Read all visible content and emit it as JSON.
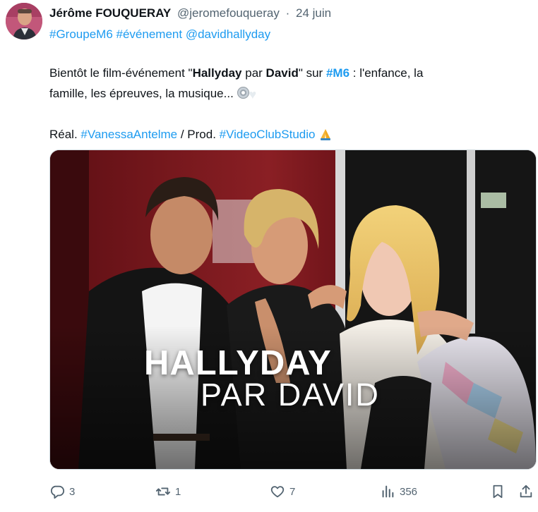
{
  "tweet": {
    "author_name": "Jérôme FOUQUERAY",
    "author_handle": "@jeromefouqueray",
    "separator": "·",
    "date": "24 juin",
    "hashtags": [
      {
        "text": "#GroupeM6"
      },
      {
        "text": "#événement"
      },
      {
        "text": "@davidhallyday"
      }
    ],
    "line1": {
      "p1": "Bientôt le film-événement \"",
      "b1": "Hallyday",
      "p2": " par ",
      "b2": "David",
      "p3": "\" sur ",
      "tag": "#M6",
      "p4": " : l'enfance, la"
    },
    "line2": {
      "text": "famille, les épreuves, la musique..."
    },
    "line3": {
      "p1": "Réal. ",
      "tag1": "#VanessaAntelme",
      "p2": " / Prod. ",
      "tag2": "#VideoClubStudio"
    },
    "media": {
      "title": "HALLYDAY",
      "subtitle": "PAR DAVID"
    },
    "stats": {
      "replies": "3",
      "reposts": "1",
      "likes": "7",
      "views": "356"
    }
  },
  "icons": {
    "reply": "reply-icon",
    "repost": "repost-icon",
    "like": "heart-icon",
    "views": "views-chart-icon",
    "bookmark": "bookmark-icon",
    "share": "share-icon"
  },
  "colors": {
    "link": "#1d9bf0",
    "muted": "#536471",
    "text": "#0f1419"
  }
}
